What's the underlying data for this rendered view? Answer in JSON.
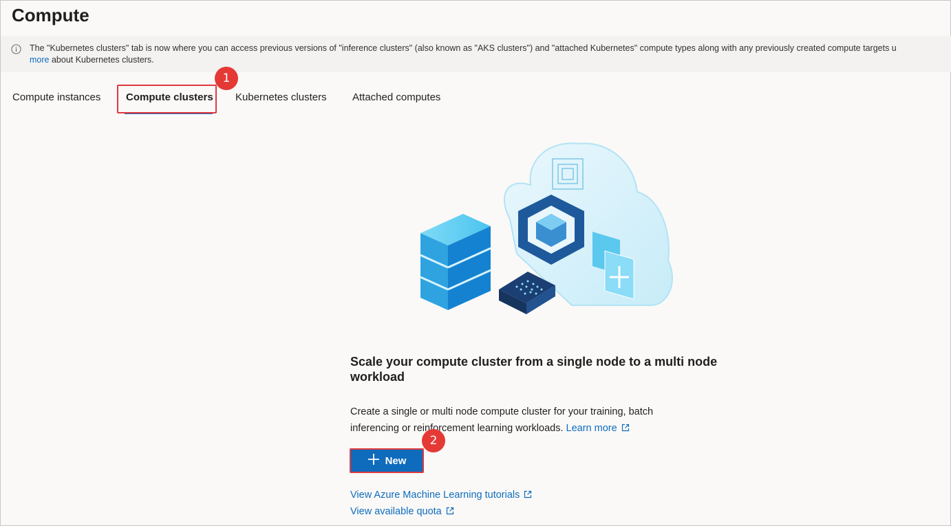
{
  "page": {
    "title": "Compute"
  },
  "banner": {
    "text_line1": "The \"Kubernetes clusters\" tab is now where you can access previous versions of \"inference clusters\" (also known as \"AKS clusters\") and \"attached Kubernetes\" compute types along with any previously created compute targets u",
    "link_label": "more",
    "text_line2": " about Kubernetes clusters.",
    "icon": "info-icon"
  },
  "tabs": [
    {
      "label": "Compute instances"
    },
    {
      "label": "Compute clusters",
      "active": true
    },
    {
      "label": "Kubernetes clusters"
    },
    {
      "label": "Attached computes"
    }
  ],
  "badges": {
    "one": "1",
    "two": "2"
  },
  "empty_state": {
    "heading": "Scale your compute cluster from a single node to a multi node workload",
    "description": "Create a single or multi node compute cluster for your training, batch inferencing or reinforcement learning workloads.",
    "learn_more": "Learn more",
    "new_button": "New",
    "tutorials_link": "View Azure Machine Learning tutorials",
    "quota_link": "View available quota"
  },
  "colors": {
    "accent": "#0f6cbd",
    "highlight": "#e0393e",
    "badge": "#e53935"
  }
}
